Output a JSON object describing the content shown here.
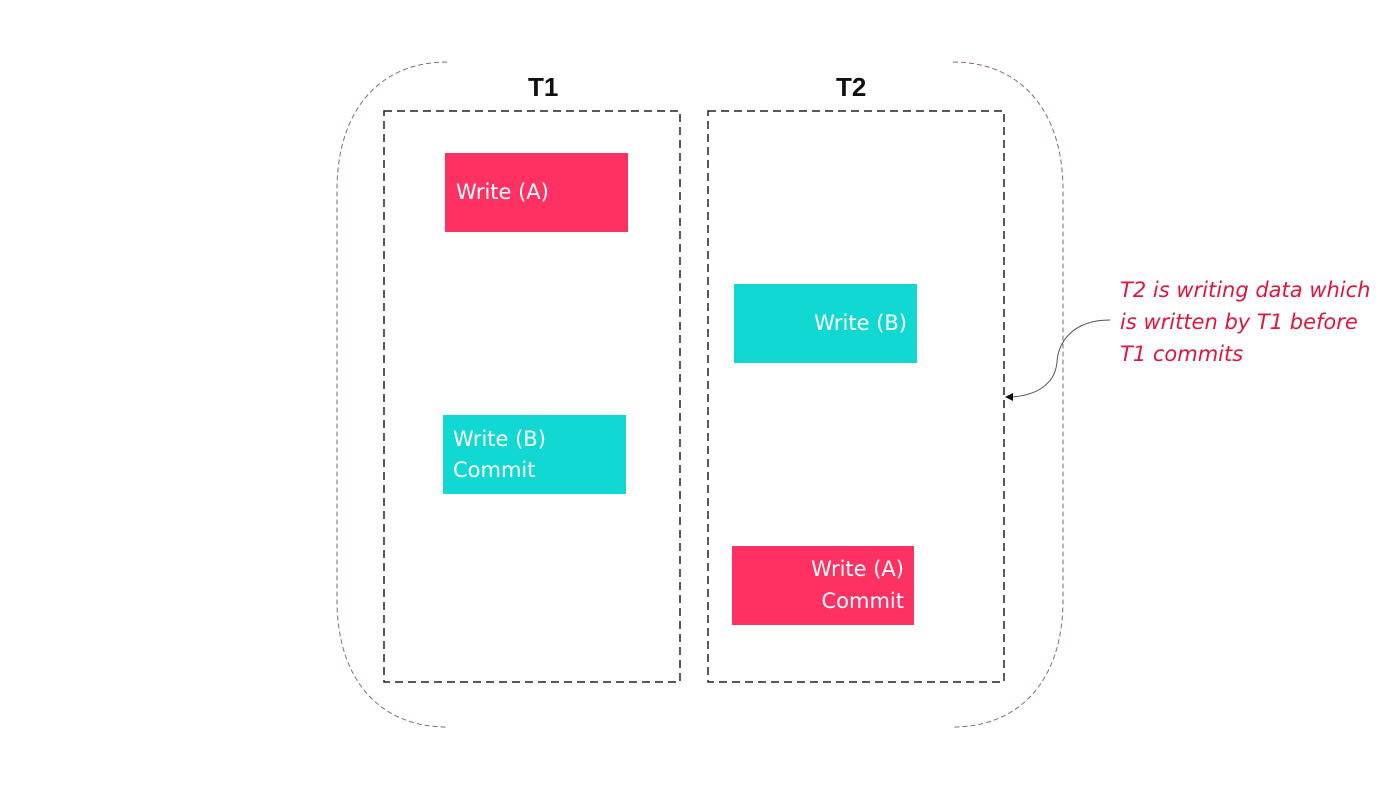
{
  "colors": {
    "write_a": "#ff3062",
    "write_b": "#12d8d4",
    "annotation": "#e0163c"
  },
  "transactions": [
    {
      "title": "T1",
      "ops": [
        {
          "lines": [
            "Write (A)"
          ],
          "color": "write_a"
        },
        {
          "lines": [
            "Write (B)",
            "Commit"
          ],
          "color": "write_b"
        }
      ]
    },
    {
      "title": "T2",
      "ops": [
        {
          "lines": [
            "Write (B)"
          ],
          "color": "write_b"
        },
        {
          "lines": [
            "Write (A)",
            "Commit"
          ],
          "color": "write_a"
        }
      ]
    }
  ],
  "annotation": "T2 is writing data which is written by T1 before T1 commits"
}
